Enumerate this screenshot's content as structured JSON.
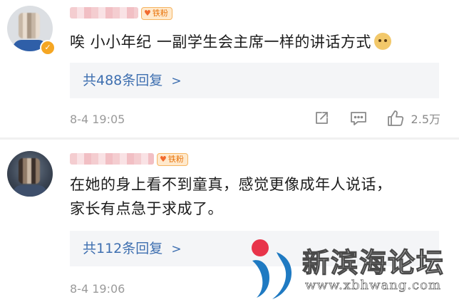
{
  "comments": [
    {
      "badge": "铁粉",
      "text_lines": [
        "唉 小小年纪 一副学生会主席一样的讲话方式"
      ],
      "emoji": "doge-emoji",
      "replies_label": "共488条回复",
      "replies_chevron": ">",
      "time": "8-4 19:05",
      "likes": "2.5万"
    },
    {
      "badge": "铁粉",
      "text_lines": [
        "在她的身上看不到童真，感觉更像成年人说话，",
        "家长有点急于求成了。"
      ],
      "replies_label": "共112条回复",
      "replies_chevron": ">",
      "time": "8-4 19:06"
    }
  ],
  "watermark": {
    "name": "新滨海论坛",
    "url": "www.xbhwang.com"
  },
  "colors": {
    "link": "#3e6fb0",
    "badge": "#e8740c",
    "verified": "#f5a623",
    "meta": "#9a9a9a"
  }
}
